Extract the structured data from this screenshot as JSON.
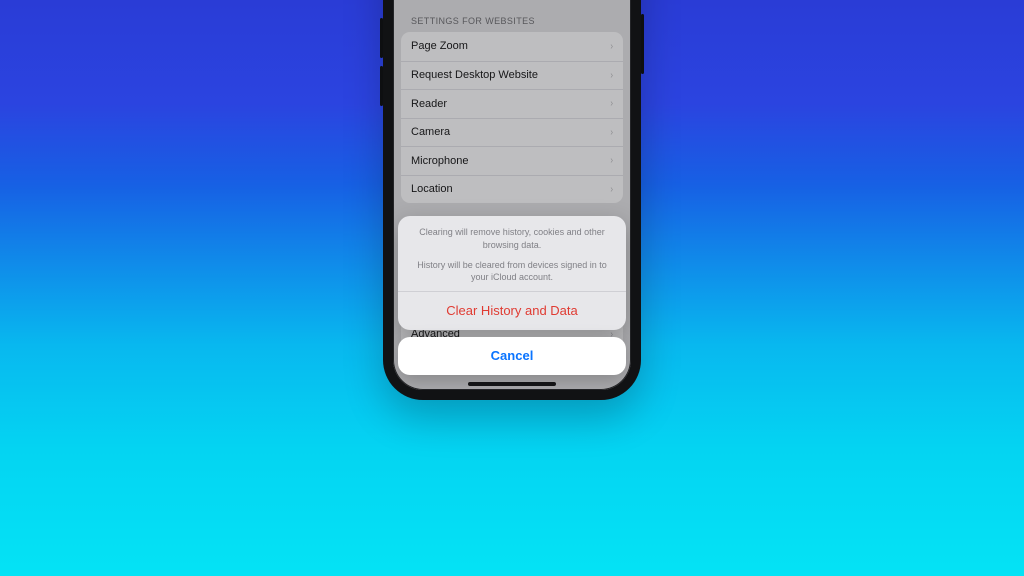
{
  "settings": {
    "section_header": "SETTINGS FOR WEBSITES",
    "rows": [
      {
        "label": "Page Zoom"
      },
      {
        "label": "Request Desktop Website"
      },
      {
        "label": "Reader"
      },
      {
        "label": "Camera"
      },
      {
        "label": "Microphone"
      },
      {
        "label": "Location"
      }
    ],
    "advanced_label": "Advanced"
  },
  "sheet": {
    "message_line1": "Clearing will remove history, cookies and other browsing data.",
    "message_line2": "History will be cleared from devices signed in to your iCloud account.",
    "clear_label": "Clear History and Data",
    "cancel_label": "Cancel"
  }
}
